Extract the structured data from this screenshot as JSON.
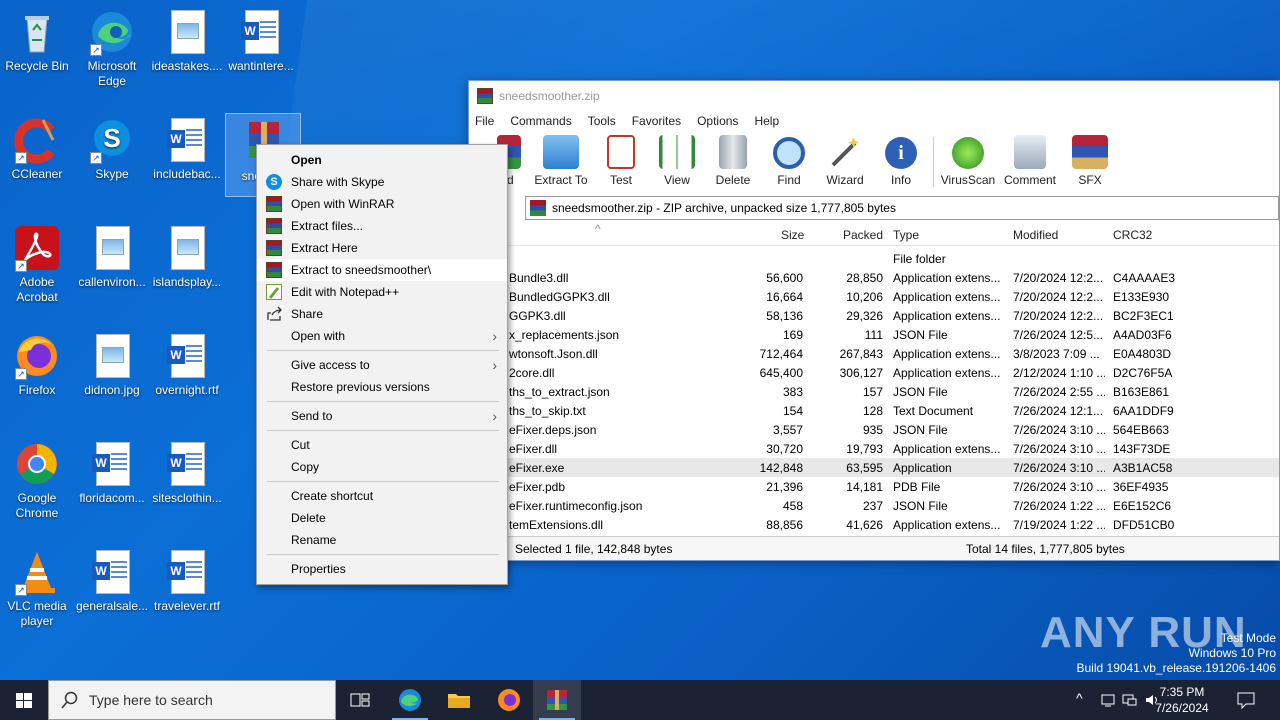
{
  "desktop": {
    "icons": [
      {
        "label": "Recycle Bin",
        "icon": "recycle-bin-icon"
      },
      {
        "label": "Microsoft Edge",
        "icon": "edge-icon"
      },
      {
        "label": "ideastakes....",
        "icon": "image-file-icon"
      },
      {
        "label": "wantintere...",
        "icon": "word-doc-icon"
      },
      {
        "label": "CCleaner",
        "icon": "ccleaner-icon"
      },
      {
        "label": "Skype",
        "icon": "skype-icon"
      },
      {
        "label": "includebac...",
        "icon": "word-doc-icon"
      },
      {
        "label": "snee he",
        "icon": "winrar-archive-icon"
      },
      {
        "label": "Adobe Acrobat",
        "icon": "acrobat-icon"
      },
      {
        "label": "callenviron...",
        "icon": "image-file-icon"
      },
      {
        "label": "islandsplay...",
        "icon": "image-file-icon"
      },
      {
        "label": "Firefox",
        "icon": "firefox-icon"
      },
      {
        "label": "didnon.jpg",
        "icon": "image-file-icon"
      },
      {
        "label": "overnight.rtf",
        "icon": "word-doc-icon"
      },
      {
        "label": "Google Chrome",
        "icon": "chrome-icon"
      },
      {
        "label": "floridacom...",
        "icon": "word-doc-icon"
      },
      {
        "label": "sitesclothin...",
        "icon": "word-doc-icon"
      },
      {
        "label": "VLC media player",
        "icon": "vlc-icon"
      },
      {
        "label": "generalsale...",
        "icon": "word-doc-icon"
      },
      {
        "label": "travelever.rtf",
        "icon": "word-doc-icon"
      }
    ]
  },
  "winrar": {
    "title": "sneedsmoother.zip",
    "menu": [
      "File",
      "Commands",
      "Tools",
      "Favorites",
      "Options",
      "Help"
    ],
    "toolbar": [
      "ld",
      "Extract To",
      "Test",
      "View",
      "Delete",
      "Find",
      "Wizard",
      "Info",
      "VirusScan",
      "Comment",
      "SFX"
    ],
    "address": "sneedsmoother.zip - ZIP archive, unpacked size 1,777,805 bytes",
    "columns": {
      "size": "Size",
      "packed": "Packed",
      "type": "Type",
      "modified": "Modified",
      "crc": "CRC32"
    },
    "rows": [
      {
        "name": "",
        "size": "",
        "packed": "",
        "type": "File folder",
        "modified": "",
        "crc": ""
      },
      {
        "name": "Bundle3.dll",
        "size": "56,600",
        "packed": "28,850",
        "type": "Application extens...",
        "modified": "7/20/2024 12:2...",
        "crc": "C4AAAAE3"
      },
      {
        "name": "BundledGGPK3.dll",
        "size": "16,664",
        "packed": "10,206",
        "type": "Application extens...",
        "modified": "7/20/2024 12:2...",
        "crc": "E133E930"
      },
      {
        "name": "GGPK3.dll",
        "size": "58,136",
        "packed": "29,326",
        "type": "Application extens...",
        "modified": "7/20/2024 12:2...",
        "crc": "BC2F3EC1"
      },
      {
        "name": "x_replacements.json",
        "size": "169",
        "packed": "111",
        "type": "JSON File",
        "modified": "7/26/2024 12:5...",
        "crc": "A4AD03F6"
      },
      {
        "name": "wtonsoft.Json.dll",
        "size": "712,464",
        "packed": "267,843",
        "type": "Application extens...",
        "modified": "3/8/2023 7:09 ...",
        "crc": "E0A4803D"
      },
      {
        "name": "2core.dll",
        "size": "645,400",
        "packed": "306,127",
        "type": "Application extens...",
        "modified": "2/12/2024 1:10 ...",
        "crc": "D2C76F5A"
      },
      {
        "name": "ths_to_extract.json",
        "size": "383",
        "packed": "157",
        "type": "JSON File",
        "modified": "7/26/2024 2:55 ...",
        "crc": "B163E861"
      },
      {
        "name": "ths_to_skip.txt",
        "size": "154",
        "packed": "128",
        "type": "Text Document",
        "modified": "7/26/2024 12:1...",
        "crc": "6AA1DDF9"
      },
      {
        "name": "eFixer.deps.json",
        "size": "3,557",
        "packed": "935",
        "type": "JSON File",
        "modified": "7/26/2024 3:10 ...",
        "crc": "564EB663"
      },
      {
        "name": "eFixer.dll",
        "size": "30,720",
        "packed": "19,793",
        "type": "Application extens...",
        "modified": "7/26/2024 3:10 ...",
        "crc": "143F73DE"
      },
      {
        "name": "eFixer.exe",
        "size": "142,848",
        "packed": "63,595",
        "type": "Application",
        "modified": "7/26/2024 3:10 ...",
        "crc": "A3B1AC58"
      },
      {
        "name": "eFixer.pdb",
        "size": "21,396",
        "packed": "14,181",
        "type": "PDB File",
        "modified": "7/26/2024 3:10 ...",
        "crc": "36EF4935"
      },
      {
        "name": "eFixer.runtimeconfig.json",
        "size": "458",
        "packed": "237",
        "type": "JSON File",
        "modified": "7/26/2024 1:22 ...",
        "crc": "E6E152C6"
      },
      {
        "name": "temExtensions.dll",
        "size": "88,856",
        "packed": "41,626",
        "type": "Application extens...",
        "modified": "7/19/2024 1:22 ...",
        "crc": "DFD51CB0"
      }
    ],
    "status_left": "Selected 1 file, 142,848 bytes",
    "status_right": "Total 14 files, 1,777,805 bytes"
  },
  "context_menu": {
    "items": [
      {
        "label": "Open",
        "bold": true
      },
      {
        "label": "Share with Skype",
        "icon": "skype-icon"
      },
      {
        "label": "Open with WinRAR",
        "icon": "winrar-icon"
      },
      {
        "label": "Extract files...",
        "icon": "winrar-icon"
      },
      {
        "label": "Extract Here",
        "icon": "winrar-icon"
      },
      {
        "label": "Extract to sneedsmoother\\",
        "icon": "winrar-icon"
      },
      {
        "label": "Edit with Notepad++",
        "icon": "notepadpp-icon"
      },
      {
        "label": "Share",
        "icon": "share-icon"
      },
      {
        "label": "Open with",
        "submenu": true
      },
      {
        "label": "Give access to",
        "submenu": true
      },
      {
        "label": "Restore previous versions"
      },
      {
        "label": "Send to",
        "submenu": true
      },
      {
        "label": "Cut"
      },
      {
        "label": "Copy"
      },
      {
        "label": "Create shortcut"
      },
      {
        "label": "Delete"
      },
      {
        "label": "Rename"
      },
      {
        "label": "Properties"
      }
    ]
  },
  "taskbar": {
    "search_placeholder": "Type here to search",
    "time": "7:35 PM",
    "date": "7/26/2024"
  },
  "watermark": {
    "brand": "ANY RUN",
    "line1": "Test Mode",
    "line2": "Windows 10 Pro",
    "line3": "Build 19041.vb_release.191206-1406"
  }
}
